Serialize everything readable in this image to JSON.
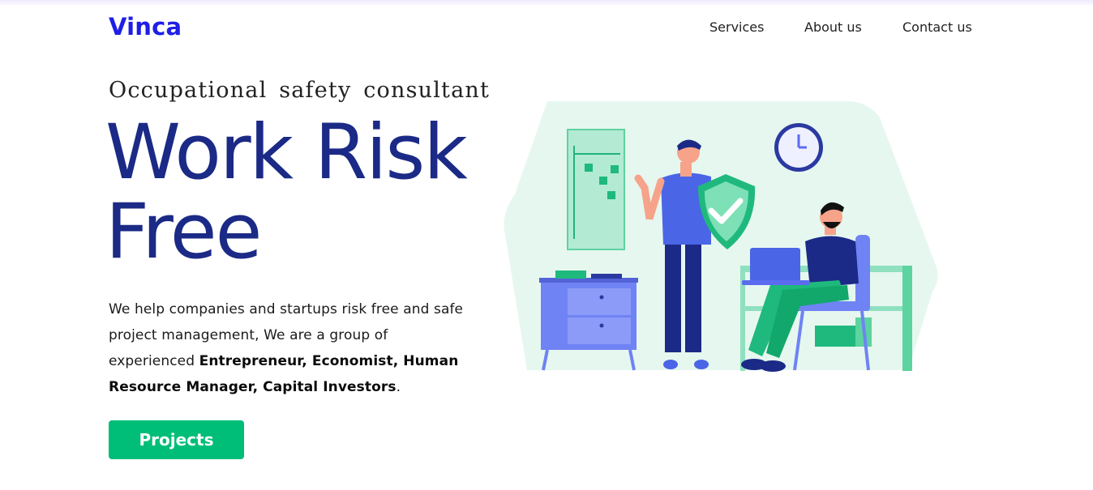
{
  "brand": {
    "name": "Vinca"
  },
  "nav": {
    "items": [
      {
        "label": "Services"
      },
      {
        "label": "About us"
      },
      {
        "label": "Contact us"
      }
    ]
  },
  "hero": {
    "eyebrow": "Occupational safety consultant",
    "title_line1": "Work Risk",
    "title_line2": "Free",
    "desc_plain1": "We help companies and startups risk free and safe project management, We are a group of experienced ",
    "desc_bold": "Entrepreneur, Economist, Human Resource Manager, Capital Investors",
    "desc_plain2": ".",
    "cta_label": "Projects"
  },
  "illustration": {
    "icons": [
      "shield-check-icon",
      "clock-icon",
      "laptop-icon"
    ]
  },
  "colors": {
    "brand": "#1f1ee6",
    "headline": "#1b2a86",
    "accent_green": "#00be78",
    "illustration_bg": "#e6f7ef"
  }
}
